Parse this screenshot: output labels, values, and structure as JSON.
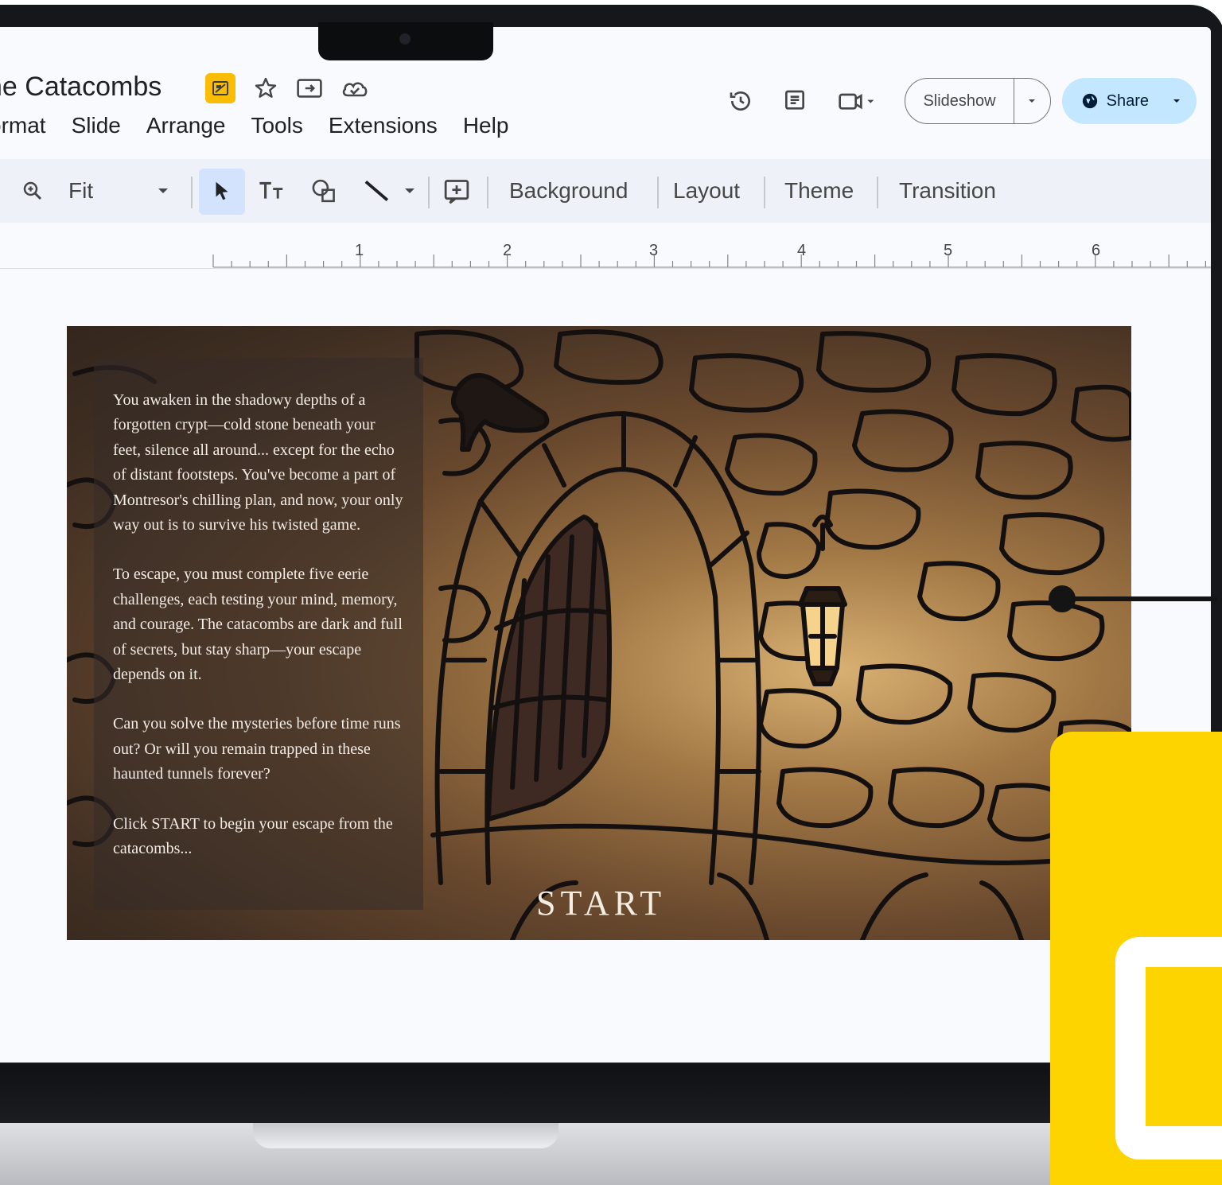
{
  "document": {
    "title": "he Catacombs"
  },
  "menu": [
    "ormat",
    "Slide",
    "Arrange",
    "Tools",
    "Extensions",
    "Help"
  ],
  "header": {
    "slideshow_label": "Slideshow",
    "share_label": "Share"
  },
  "toolbar": {
    "zoom_label": "Fit",
    "background_label": "Background",
    "layout_label": "Layout",
    "theme_label": "Theme",
    "transition_label": "Transition"
  },
  "ruler": {
    "marks": [
      "1",
      "2",
      "3",
      "4",
      "5",
      "6"
    ]
  },
  "slide": {
    "paragraphs": [
      "You awaken in the shadowy depths of a forgotten crypt—cold stone beneath your feet, silence all around... except for the echo of distant footsteps. You've become a part of Montresor's chilling plan, and now, your only way out is to survive his twisted game.",
      "To escape, you must complete five eerie challenges, each testing your mind, memory, and courage. The catacombs are dark and full of secrets, but stay sharp—your escape depends on it.",
      "Can you solve the mysteries before time runs out? Or will you remain trapped in these haunted tunnels forever?",
      "Click START to begin your escape from the catacombs..."
    ],
    "start_label": "START"
  },
  "icons": {
    "slides_badge": "slides-move-icon",
    "star": "star-icon",
    "move_to_folder": "move-to-folder-icon",
    "cloud_saved": "cloud-saved-icon",
    "history": "version-history-icon",
    "comments": "comments-icon",
    "meet": "meet-camera-icon",
    "zoom": "zoom-icon",
    "select": "select-cursor-icon",
    "text_box": "text-box-icon",
    "shape": "shape-icon",
    "line": "line-icon",
    "comment_add": "add-comment-icon",
    "globe": "globe-icon"
  },
  "colors": {
    "share_bg": "#c2e7ff",
    "toolbar_bg": "#eef1f8",
    "brand_yellow": "#fdd400",
    "select_active": "#d3e3fd"
  }
}
